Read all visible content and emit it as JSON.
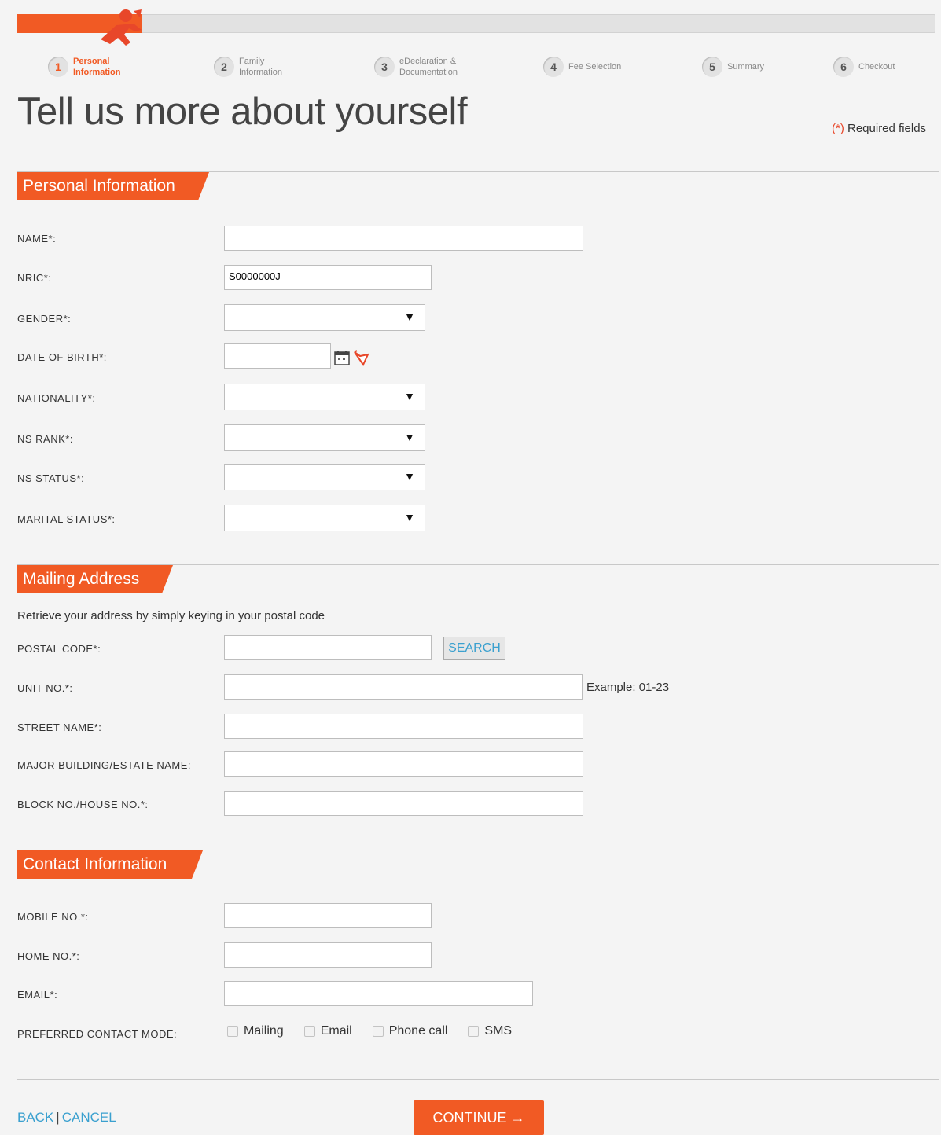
{
  "steps": [
    {
      "num": "1",
      "label": "Personal\nInformation"
    },
    {
      "num": "2",
      "label": "Family\nInformation"
    },
    {
      "num": "3",
      "label": "eDeclaration &\nDocumentation"
    },
    {
      "num": "4",
      "label": "Fee Selection"
    },
    {
      "num": "5",
      "label": "Summary"
    },
    {
      "num": "6",
      "label": "Checkout"
    }
  ],
  "page_title": "Tell us more about yourself",
  "required_note": {
    "star": "(*)",
    "text": " Required fields"
  },
  "personal": {
    "heading": "Personal Information",
    "name_label": "NAME*:",
    "nric_label": "NRIC*:",
    "nric_value": "S0000000J",
    "gender_label": "GENDER*:",
    "dob_label": "DATE OF BIRTH*:",
    "nationality_label": "NATIONALITY*:",
    "ns_rank_label": "NS RANK*:",
    "ns_status_label": "NS STATUS*:",
    "marital_label": "MARITAL STATUS*:"
  },
  "mailing": {
    "heading": "Mailing Address",
    "intro": "Retrieve your address by simply keying in your postal code",
    "postal_label": "POSTAL CODE*:",
    "search_label": "SEARCH",
    "unit_label": "UNIT NO.*:",
    "unit_hint": "Example: 01-23",
    "street_label": "STREET NAME*:",
    "building_label": "MAJOR BUILDING/ESTATE NAME:",
    "block_label": "BLOCK NO./HOUSE NO.*:"
  },
  "contact": {
    "heading": "Contact Information",
    "mobile_label": "MOBILE NO.*:",
    "home_label": "HOME NO.*:",
    "email_label": "EMAIL*:",
    "mode_label": "PREFERRED CONTACT MODE:",
    "modes": [
      "Mailing",
      "Email",
      "Phone call",
      "SMS"
    ]
  },
  "footer": {
    "back": "BACK",
    "sep": "|",
    "cancel": "CANCEL",
    "continue": "CONTINUE →"
  },
  "colors": {
    "accent": "#f15a24",
    "link": "#3aa0cf"
  },
  "icons": {
    "select_arrow": "▼"
  }
}
